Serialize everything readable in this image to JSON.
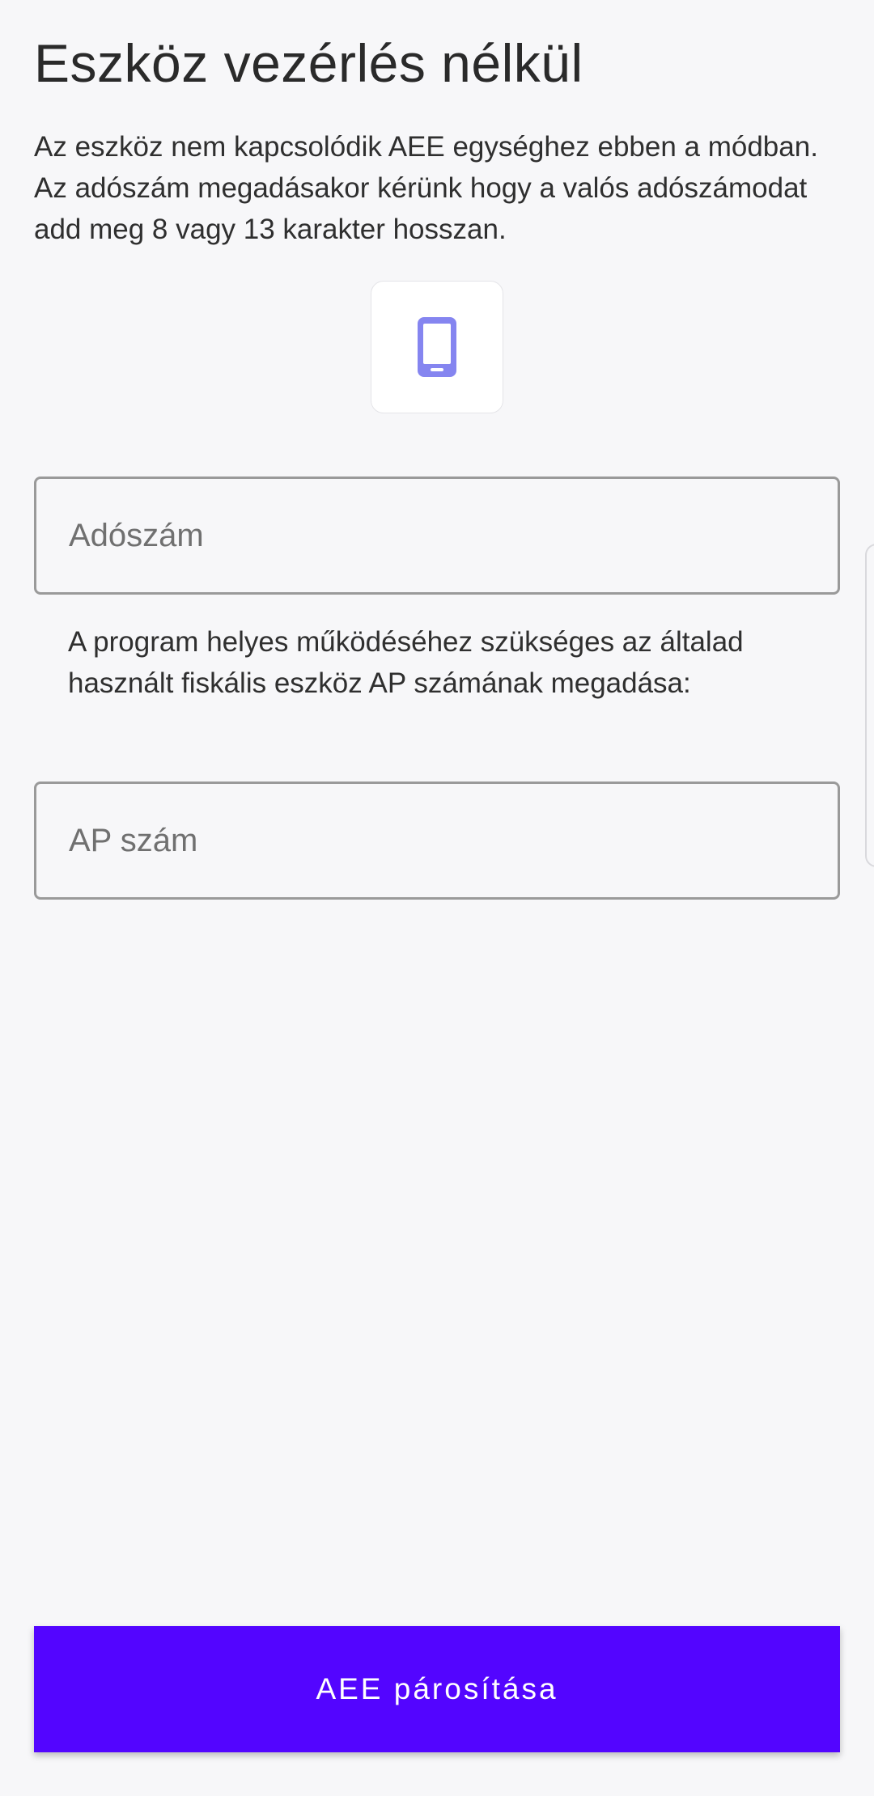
{
  "page": {
    "title": "Eszköz vezérlés nélkül",
    "description": "Az eszköz nem kapcsolódik AEE egységhez ebben a módban. Az adószám megadásakor kérünk hogy a valós adószámodat add meg 8 vagy 13 karakter hosszan."
  },
  "device_icon": {
    "icon": "smartphone-icon",
    "color": "#8585f0"
  },
  "form": {
    "tax_number": {
      "value": "",
      "placeholder": "Adószám"
    },
    "helper_text": "A program helyes működéséhez szükséges az általad használt fiskális eszköz AP számának megadása:",
    "ap_number": {
      "value": "",
      "placeholder": "AP szám"
    }
  },
  "actions": {
    "pair_button_label": "AEE párosítása",
    "accent_color": "#5305ff"
  }
}
